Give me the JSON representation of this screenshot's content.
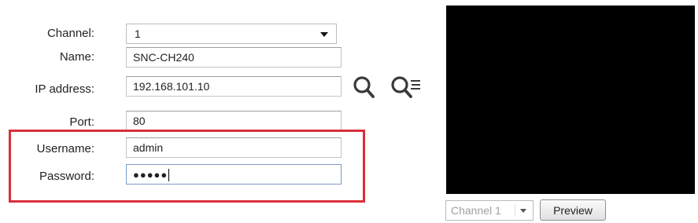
{
  "form": {
    "channel": {
      "label": "Channel:",
      "value": "1"
    },
    "name": {
      "label": "Name:",
      "value": "SNC-CH240"
    },
    "ip_address": {
      "label": "IP address:",
      "value": "192.168.101.10"
    },
    "port": {
      "label": "Port:",
      "value": "80"
    },
    "username": {
      "label": "Username:",
      "value": "admin"
    },
    "password": {
      "label": "Password:",
      "masked_value": "●●●●●"
    }
  },
  "icons": {
    "search": "search-icon",
    "search_list": "search-list-icon"
  },
  "preview": {
    "channel_select_value": "Channel 1",
    "button_label": "Preview"
  },
  "colors": {
    "highlight": "#d9303a",
    "preview_background": "#000000"
  }
}
